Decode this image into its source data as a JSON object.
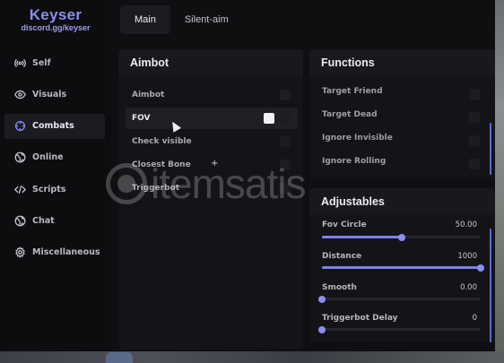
{
  "brand": {
    "title": "Keyser",
    "subtitle": "discord.gg/keyser"
  },
  "sidebar": {
    "items": [
      {
        "label": "Self",
        "icon": "broadcast-icon"
      },
      {
        "label": "Visuals",
        "icon": "eye-icon"
      },
      {
        "label": "Combats",
        "icon": "crosshair-icon",
        "active": true
      },
      {
        "label": "Online",
        "icon": "globe-icon"
      },
      {
        "label": "Scripts",
        "icon": "code-icon"
      },
      {
        "label": "Chat",
        "icon": "globe-icon"
      },
      {
        "label": "Miscellaneous",
        "icon": "gear-icon"
      }
    ]
  },
  "tabs": [
    {
      "label": "Main",
      "active": true
    },
    {
      "label": "Silent-aim"
    }
  ],
  "aimbot": {
    "title": "Aimbot",
    "options": [
      {
        "label": "Aimbot",
        "checked": false
      },
      {
        "label": "FOV",
        "checked": true
      },
      {
        "label": "Check visible",
        "checked": false
      },
      {
        "label": "Closest Bone",
        "checked": false
      },
      {
        "label": "Triggerbot",
        "checked": false
      }
    ]
  },
  "functions": {
    "title": "Functions",
    "options": [
      {
        "label": "Target Friend",
        "checked": false
      },
      {
        "label": "Target Dead",
        "checked": false
      },
      {
        "label": "Ignore Invisible",
        "checked": false
      },
      {
        "label": "Ignore Rolling",
        "checked": false
      }
    ]
  },
  "adjustables": {
    "title": "Adjustables",
    "sliders": [
      {
        "label": "Fov Circle",
        "value": "50.00",
        "fraction": 0.5
      },
      {
        "label": "Distance",
        "value": "1000",
        "fraction": 1.0
      },
      {
        "label": "Smooth",
        "value": "0.00",
        "fraction": 0.0
      },
      {
        "label": "Triggerbot Delay",
        "value": "0",
        "fraction": 0.0
      }
    ]
  },
  "watermark": {
    "text": "itemsatis"
  },
  "colors": {
    "accent": "#8b8ff0",
    "panel": "#141418",
    "background": "#0f0f12"
  }
}
